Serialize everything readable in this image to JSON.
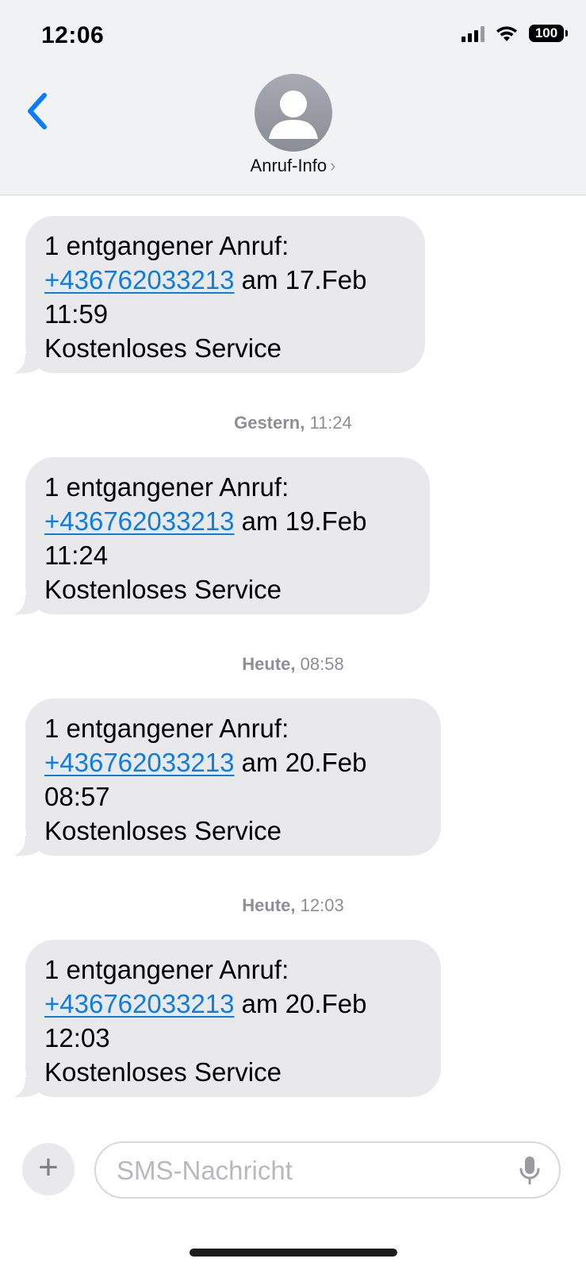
{
  "status_bar": {
    "time": "12:06",
    "battery": "100"
  },
  "header": {
    "contact_name": "Anruf-Info",
    "chevron": "›",
    "back_icon": "chevron-left-icon",
    "avatar_icon": "person-silhouette-icon"
  },
  "messages": [
    {
      "timestamp": "",
      "lines": [
        "1 entgangener Anruf:",
        "+436762033213",
        " am 17.Feb",
        "11:59",
        "Kostenloses Service"
      ]
    },
    {
      "timestamp_day": "Gestern,",
      "timestamp_time": " 11:24",
      "lines": [
        "1 entgangener Anruf:",
        "+436762033213",
        " am 19.Feb",
        "11:24",
        "Kostenloses Service"
      ]
    },
    {
      "timestamp_day": "Heute,",
      "timestamp_time": " 08:58",
      "lines": [
        "1 entgangener Anruf:",
        "+436762033213",
        " am 20.Feb",
        "08:57",
        "Kostenloses Service"
      ]
    },
    {
      "timestamp_day": "Heute,",
      "timestamp_time": " 12:03",
      "lines": [
        "1 entgangener Anruf:",
        "+436762033213",
        " am 20.Feb",
        "12:03",
        "Kostenloses Service"
      ]
    }
  ],
  "composer": {
    "plus": "+",
    "placeholder": "SMS-Nachricht",
    "mic_icon": "microphone-icon"
  },
  "colors": {
    "bubble": "#e9e9eb",
    "link": "#0b7de6",
    "accent": "#0a7cff",
    "header_bg": "#f1f2f4"
  }
}
